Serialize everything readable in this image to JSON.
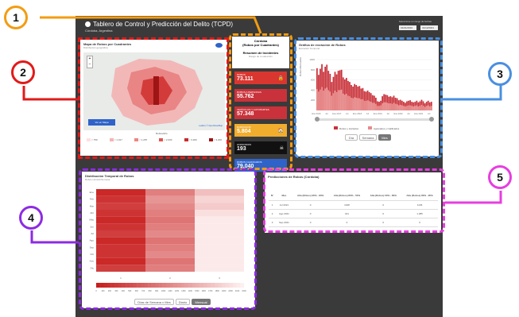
{
  "header": {
    "title": "Tablero de Control y Predicción del Delito (TCPD)",
    "subtitle": "Córdoba, Argentina",
    "note": "Seleccione un rango de fechas",
    "date_from": "01/01/2016",
    "date_to": "31/12/2021"
  },
  "callouts": [
    "1",
    "2",
    "3",
    "4",
    "5"
  ],
  "map": {
    "title": "Mapa de Robos por Cuadrantes",
    "subtitle": "Distribución geográfica",
    "zoom_in": "+",
    "zoom_out": "−",
    "legend_title": "Robos/año",
    "legend": [
      "< 750",
      "< 1.017",
      "< 1.287",
      "< 2.000",
      "< 3.200",
      "> 3.200"
    ],
    "button": "Ver en Mapa",
    "attribution": "Leaflet | © OpenStreetMap"
  },
  "summary": {
    "title": "Córdoba",
    "title2": "(Robos por Cuadrantes)",
    "resume_title": "Resumen de Incidentes",
    "resume_sub": "Rango de tu selección",
    "kpis": [
      {
        "label": "ROBOS",
        "value": "73.111",
        "icon": "🔒",
        "color": "#d9362f"
      },
      {
        "label": "ROBOS A PERSONAS",
        "value": "55.762",
        "icon": "",
        "color": "#c9323a"
      },
      {
        "label": "VEHÍCULOS Y AUTOPARTES",
        "value": "57.348",
        "icon": "",
        "color": "#c9323a"
      },
      {
        "label": "DOMICILIOS",
        "value": "5.804",
        "icon": "🏠",
        "color": "#f0ad2e"
      },
      {
        "label": "HOMICIDIOS",
        "value": "193",
        "icon": "☠",
        "color": "#111111"
      },
      {
        "label": "ROBOS CALIFICADOS",
        "value": "79.040",
        "icon": "",
        "color": "#2f63c9"
      }
    ]
  },
  "evolution": {
    "title": "Gráfica de evolución de Robos",
    "subtitle": "Evolución Temporal",
    "ylabel": "Robos Mensuales",
    "xticks": [
      "Ene 2016",
      "Jul",
      "Ene 2017",
      "Jul",
      "Ene 2018",
      "Jul",
      "Ene 2019",
      "Jul",
      "Ene 2020",
      "Jul",
      "Ene 2021",
      "Jul"
    ],
    "yticks": [
      "1000",
      "800",
      "600",
      "400",
      "200"
    ],
    "legend": [
      "Robos y Hurtados",
      "Agravados y Calificados"
    ],
    "buttons": [
      "Día",
      "Semana",
      "Mes"
    ]
  },
  "chart_data": {
    "type": "bar",
    "ylabel": "Robos Mensuales",
    "series": [
      {
        "name": "Robos y Hurtados",
        "values": [
          830,
          700,
          820,
          910,
          760,
          860,
          900,
          780,
          720,
          560,
          660,
          760,
          710,
          780,
          790,
          800,
          650,
          610,
          640,
          580,
          560,
          500,
          470,
          520,
          500,
          470,
          480,
          430,
          440,
          380,
          370,
          390,
          360,
          340,
          300,
          290,
          250,
          180,
          170,
          190,
          280,
          320,
          310,
          300,
          270,
          280,
          260,
          290,
          250,
          240,
          200,
          210,
          190,
          170,
          150,
          180,
          190,
          200,
          170,
          160,
          170,
          190,
          160,
          180,
          210,
          180,
          140,
          170,
          190,
          160,
          170
        ]
      },
      {
        "name": "Agravados y Calificados",
        "values": [
          420,
          370,
          410,
          460,
          390,
          430,
          450,
          400,
          370,
          290,
          340,
          390,
          360,
          400,
          400,
          410,
          330,
          310,
          330,
          290,
          280,
          250,
          240,
          260,
          250,
          240,
          240,
          220,
          220,
          190,
          190,
          200,
          180,
          170,
          150,
          150,
          130,
          90,
          90,
          100,
          140,
          160,
          160,
          150,
          140,
          140,
          130,
          150,
          130,
          120,
          100,
          110,
          100,
          90,
          80,
          90,
          100,
          100,
          90,
          80,
          90,
          100,
          80,
          90,
          110,
          90,
          70,
          90,
          100,
          80,
          90
        ]
      }
    ]
  },
  "temporal": {
    "title": "Distribución Temporal de Robos",
    "subtitle": "Robos Horario/Semana",
    "rows": [
      "Ene",
      "Feb",
      "Mar",
      "Abr",
      "May",
      "Jun",
      "Jul",
      "Ago",
      "Sep",
      "Oct",
      "Nov",
      "Dic"
    ],
    "cols": [
      "1",
      "2",
      "3"
    ],
    "scale": [
      "0",
      "100",
      "200",
      "300",
      "400",
      "500",
      "600",
      "700",
      "800",
      "900",
      "1000",
      "1100",
      "1200",
      "1300",
      "1400",
      "1500",
      "1600",
      "1700",
      "1800",
      "1900",
      "2000",
      "2100",
      "2200"
    ],
    "buttons": [
      "Días de Semana x Mes",
      "Diario",
      "Mensual"
    ]
  },
  "predictions": {
    "title": "Predicciones de Robos (Córdoba)",
    "headers": [
      "N°",
      "Mes",
      "Alta (Robos) 95% - 80%",
      "Alta (Robos) 80% - 50%",
      "Alta (Robos) 50% - 80%",
      "Alta (Robos) 80% - 95%"
    ],
    "rows": [
      [
        "1",
        "Jul 2021",
        "0",
        "1348",
        "0",
        "1136"
      ],
      [
        "2",
        "Ago 2021",
        "0",
        "441",
        "0",
        "1.285"
      ],
      [
        "3",
        "Sep 2021",
        "0",
        "0",
        "0",
        "0"
      ]
    ]
  }
}
